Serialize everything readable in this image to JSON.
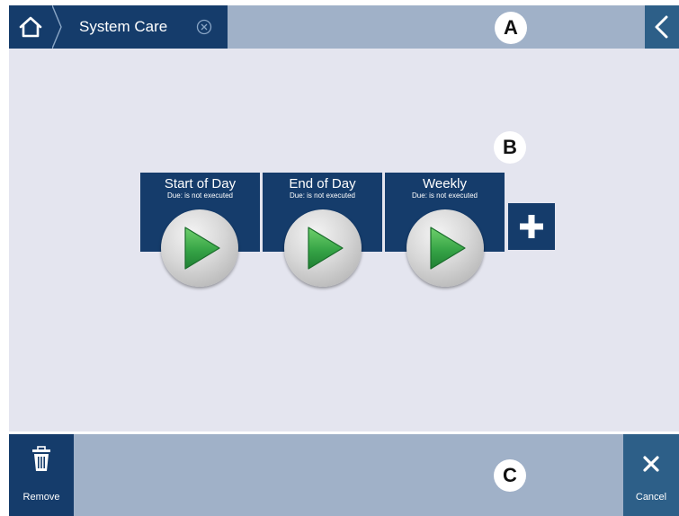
{
  "header": {
    "home_icon": "home-icon",
    "breadcrumb_label": "System Care",
    "close_icon": "close-circle-icon",
    "back_icon": "chevron-left-icon",
    "callout": "A"
  },
  "main": {
    "callout": "B",
    "tiles": [
      {
        "title": "Start of Day",
        "due": "Due: is not executed",
        "icon": "play-icon"
      },
      {
        "title": "End of Day",
        "due": "Due: is not executed",
        "icon": "play-icon"
      },
      {
        "title": "Weekly",
        "due": "Due: is not executed",
        "icon": "play-icon"
      }
    ],
    "add_icon": "plus-icon"
  },
  "footer": {
    "callout": "C",
    "remove_label": "Remove",
    "remove_icon": "trash-icon",
    "cancel_label": "Cancel",
    "cancel_icon": "close-icon"
  },
  "colors": {
    "primary": "#153c6b",
    "secondary": "#2d5f88",
    "bar": "#a0b1c8",
    "background": "#e4e5ef",
    "play_green": "#3aa64a"
  }
}
